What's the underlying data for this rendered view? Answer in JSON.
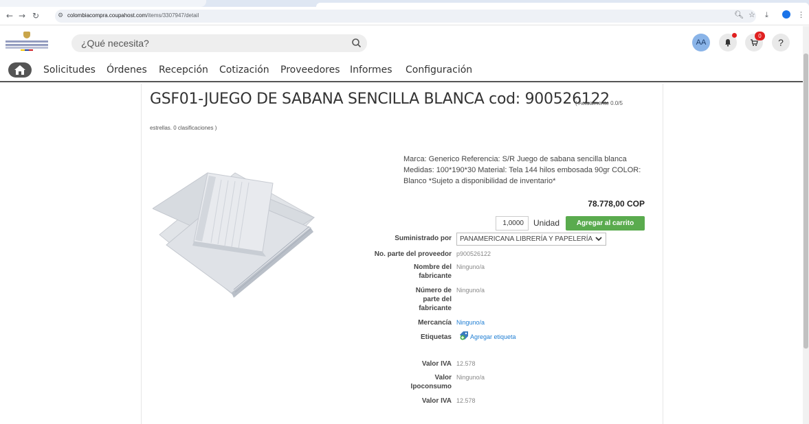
{
  "browser": {
    "url_host": "colombiacompra.coupahost.com",
    "url_path": "/items/3307947/detail"
  },
  "header": {
    "logo_text": "Agencia Nacional de Contratación Pública Colombia Compra Eficiente",
    "search_placeholder": "¿Qué necesita?",
    "avatar_initials": "AA",
    "cart_count": "0",
    "help_label": "?"
  },
  "nav": {
    "items": [
      "Solicitudes",
      "Órdenes",
      "Recepción",
      "Cotización",
      "Proveedores",
      "Informes",
      "Configuración"
    ]
  },
  "product": {
    "title": "GSF01-JUEGO DE SABANA SENCILLA BLANCA cod: 900526122",
    "rating_part1": "( Actualmente 0.0/5",
    "rating_part2": "estrellas. 0 clasificaciones )",
    "description": "Marca: Generico Referencia: S/R Juego de sabana sencilla blanca Medidas: 100*190*30 Material: Tela 144 hilos embosada 90gr COLOR: Blanco *Sujeto a disponibilidad de inventario*",
    "price": "78.778,00 COP",
    "quantity": "1,0000",
    "unit": "Unidad",
    "add_to_cart": "Agregar al carrito"
  },
  "fields": {
    "supplier_label": "Suministrado por",
    "supplier_value": "PANAMERICANA LIBRERÍA Y PAPELERÍA",
    "supplier_part_label": "No. parte del proveedor",
    "supplier_part_value": "p900526122",
    "manufacturer_label_1": "Nombre del",
    "manufacturer_label_2": "fabricante",
    "manufacturer_value": "Ninguno/a",
    "mfr_part_label_1": "Número de",
    "mfr_part_label_2": "parte del",
    "mfr_part_label_3": "fabricante",
    "mfr_part_value": "Ninguno/a",
    "commodity_label": "Mercancía",
    "commodity_value": "Ninguno/a",
    "tags_label": "Etiquetas",
    "tags_value": "Agregar etiqueta",
    "iva_label": "Valor IVA",
    "iva_value": "12.578",
    "ipoconsumo_label_1": "Valor",
    "ipoconsumo_label_2": "Ipoconsumo",
    "ipoconsumo_value": "Ninguno/a",
    "iva2_label": "Valor IVA",
    "iva2_value": "12.578"
  },
  "colors": {
    "button_green": "#5aab4e",
    "link_blue": "#1f7ed3",
    "badge_red": "#e02020"
  }
}
